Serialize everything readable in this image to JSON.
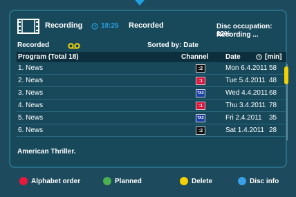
{
  "header": {
    "mode_label": "Recording",
    "clock": "18:25",
    "tab_label": "Recorded",
    "disc_occupation": "Disc occupation: 32%",
    "recording_status": "Recording ..."
  },
  "section": {
    "title": "Recorded",
    "sorted_by": "Sorted by: Date"
  },
  "table": {
    "headers": {
      "program": "Program (Total 18)",
      "channel": "Channel",
      "date": "Date",
      "minutes": "[min]"
    },
    "rows": [
      {
        "program": "1. News",
        "channel": ":2",
        "channel_type": "c2",
        "date": "Mon 6.4.2011",
        "minutes": "58"
      },
      {
        "program": "2. News",
        "channel": ":1",
        "channel_type": "c1",
        "date": "Tue 5.4.2011",
        "minutes": "48"
      },
      {
        "program": "3. News",
        "channel": "TA3",
        "channel_type": "ta3",
        "date": "Wed 4.4.2011",
        "minutes": "68"
      },
      {
        "program": "4. News",
        "channel": ":1",
        "channel_type": "c1",
        "date": "Thu 3.4.2011",
        "minutes": "78"
      },
      {
        "program": "5. News",
        "channel": "TA3",
        "channel_type": "ta3",
        "date": "Fri 2.4.2011",
        "minutes": "35"
      },
      {
        "program": "6. News",
        "channel": ":2",
        "channel_type": "c2",
        "date": "Sat 1.4.2011",
        "minutes": "28"
      }
    ]
  },
  "description": "American Thriller.",
  "footer": {
    "red_label": "Alphabet order",
    "green_label": "Planned",
    "yellow_label": "Delete",
    "blue_label": "Disc info"
  },
  "colors": {
    "background": "#1d4a5c",
    "accent_blue": "#2b9fe0",
    "scroll_thumb": "#f5d000",
    "red": "#e8193c",
    "green": "#4caf50",
    "yellow": "#f5d000",
    "blue": "#3aa0e8"
  }
}
